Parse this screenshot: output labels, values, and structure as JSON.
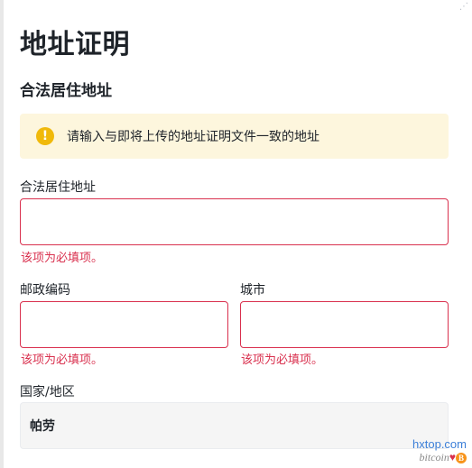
{
  "page": {
    "title": "地址证明",
    "section_title": "合法居住地址",
    "corner_glyph": "⋰"
  },
  "notice": {
    "icon": "warning-icon",
    "icon_glyph": "!",
    "text": "请输入与即将上传的地址证明文件一致的地址",
    "bg_color": "#fdf6dd",
    "icon_color": "#f0b90b"
  },
  "form": {
    "address": {
      "label": "合法居住地址",
      "value": "",
      "error": "该项为必填项。"
    },
    "postal_code": {
      "label": "邮政编码",
      "value": "",
      "error": "该项为必填项。"
    },
    "city": {
      "label": "城市",
      "value": "",
      "error": "该项为必填项。"
    },
    "country": {
      "label": "国家/地区",
      "value": "帕劳"
    }
  },
  "colors": {
    "error": "#d9304e",
    "text": "#1e2329"
  },
  "watermark": {
    "site": "hxtop.com",
    "brand": "bitcoin",
    "heart": "♥",
    "coin": "B"
  }
}
